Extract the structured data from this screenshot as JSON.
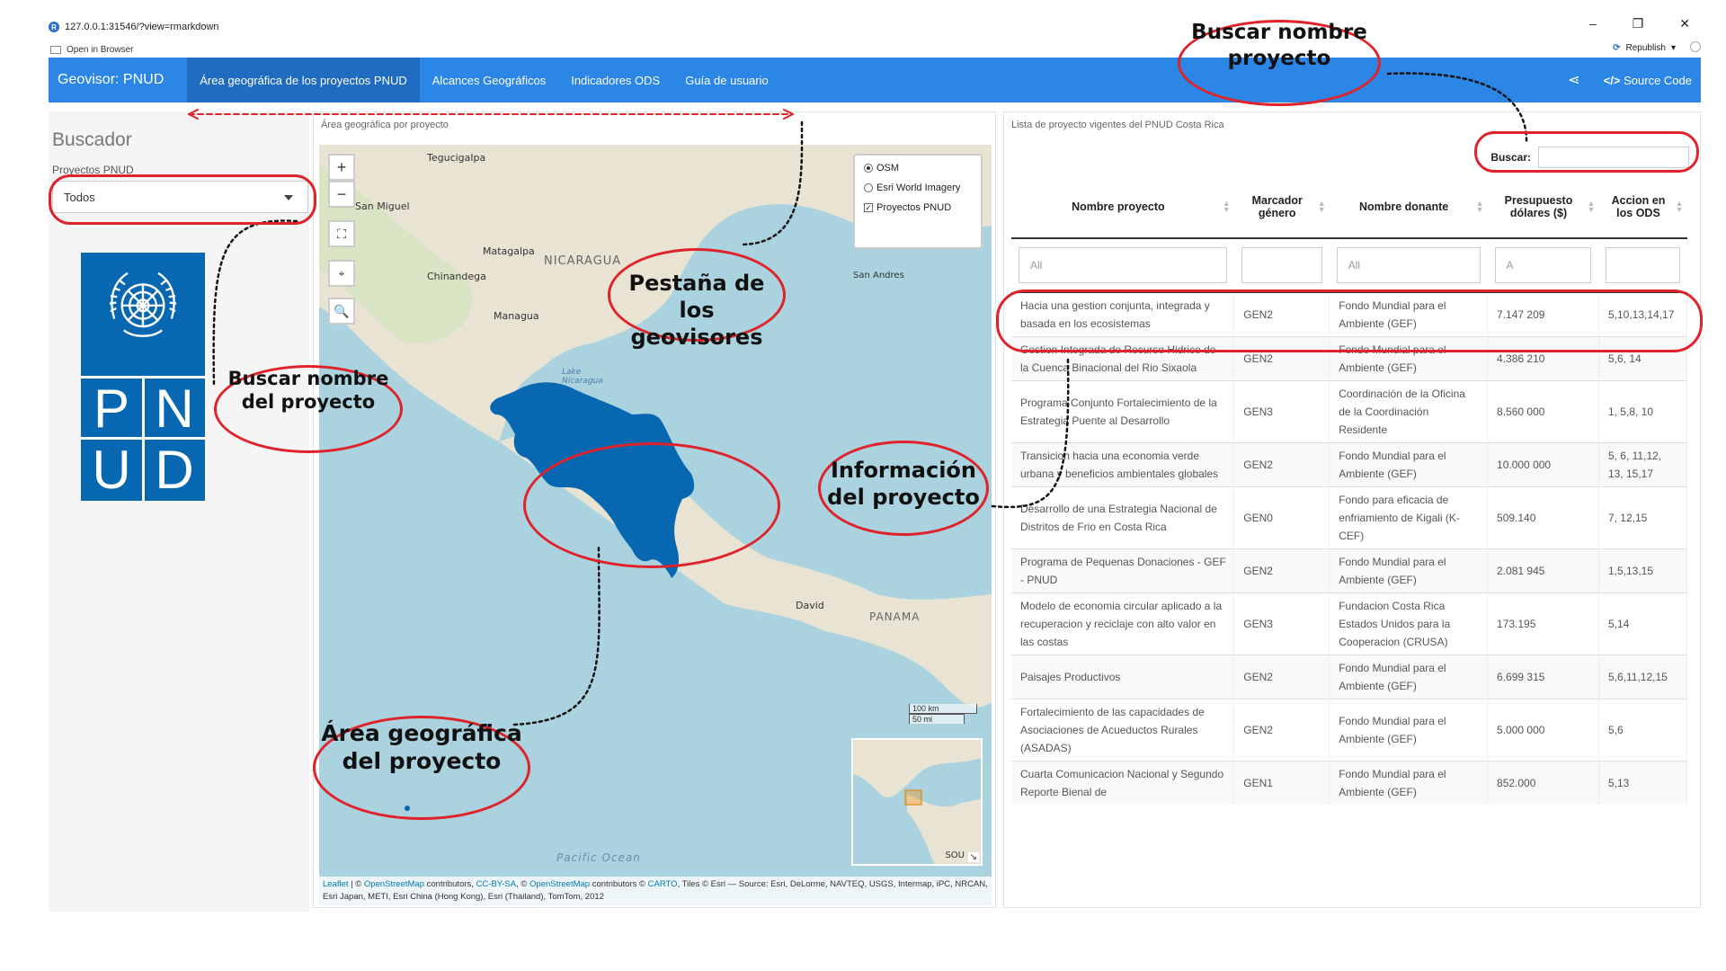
{
  "browser": {
    "url": "127.0.0.1:31546/?view=rmarkdown",
    "open_in_browser": "Open in Browser",
    "republish": "Republish"
  },
  "navbar": {
    "brand": "Geovisor: PNUD",
    "tabs": [
      {
        "label": "Área geográfica de los proyectos PNUD",
        "active": true
      },
      {
        "label": "Alcances Geográficos",
        "active": false
      },
      {
        "label": "Indicadores ODS",
        "active": false
      },
      {
        "label": "Guía de usuario",
        "active": false
      }
    ],
    "source_code": "Source Code"
  },
  "sidebar": {
    "title": "Buscador",
    "select_label": "Proyectos PNUD",
    "select_value": "Todos",
    "logo_letters": [
      "P",
      "N",
      "U",
      "D"
    ]
  },
  "map": {
    "heading": "Área geográfica por proyecto",
    "layers": [
      {
        "label": "OSM",
        "type": "radio",
        "checked": true
      },
      {
        "label": "Esri World Imagery",
        "type": "radio",
        "checked": false
      },
      {
        "label": "Proyectos PNUD",
        "type": "checkbox",
        "checked": true
      }
    ],
    "place_labels": [
      "Tegucigalpa",
      "San Miguel",
      "Matagalpa",
      "Chinandega",
      "NICARAGUA",
      "Managua",
      "Lake Nicaragua",
      "San Andres",
      "David",
      "PANAMA",
      "Pacific Ocean"
    ],
    "scale_km": "100 km",
    "scale_mi": "50 mi",
    "minimap_label": "SOU",
    "attribution": {
      "leaflet": "Leaflet",
      "osm1": "OpenStreetMap",
      "t1": " contributors, ",
      "ccbysa": "CC-BY-SA",
      "t2": ", © ",
      "osm2": "OpenStreetMap",
      "t3": " contributors © ",
      "carto": "CARTO",
      "t4": ", Tiles © Esri — Source: Esri, DeLorme, NAVTEQ, USGS, Intermap, iPC, NRCAN, Esri Japan, METI, Esri China (Hong Kong), Esri (Thailand), TomTom, 2012"
    },
    "project_color": "#0767b0"
  },
  "table": {
    "heading": "Lista de proyecto vigentes del PNUD Costa Rica",
    "search_label": "Buscar:",
    "columns": [
      "Nombre proyecto",
      "Marcador género",
      "Nombre donante",
      "Presupuesto dólares ($)",
      "Accion en los ODS"
    ],
    "filters": [
      "All",
      "",
      "All",
      "A",
      ""
    ],
    "rows": [
      [
        "Hacia una gestion conjunta, integrada y basada en los ecosistemas",
        "GEN2",
        "Fondo Mundial para el Ambiente (GEF)",
        "7.147 209",
        "5,10,13,14,17"
      ],
      [
        "Gestion Integrada de Recurso Hidrico de la Cuenca Binacional del Rio Sixaola",
        "GEN2",
        "Fondo Mundial para el Ambiente (GEF)",
        "4.386 210",
        "5,6, 14"
      ],
      [
        "Programa Conjunto Fortalecimiento de la Estrategia Puente al Desarrollo",
        "GEN3",
        "Coordinación de la Oficina de la Coordinación Residente",
        "8.560 000",
        "1, 5,8, 10"
      ],
      [
        "Transicion hacia una economia verde urbana y beneficios ambientales globales",
        "GEN2",
        "Fondo Mundial para el Ambiente (GEF)",
        "10.000 000",
        "5, 6, 11,12, 13, 15,17"
      ],
      [
        "Desarrollo de una Estrategia Nacional de Distritos de Frio en Costa Rica",
        "GEN0",
        "Fondo para eficacia de enfriamiento de Kigali (K-CEF)",
        "509.140",
        "7, 12,15"
      ],
      [
        "Programa de Pequenas Donaciones - GEF - PNUD",
        "GEN2",
        "Fondo Mundial para el Ambiente (GEF)",
        "2.081 945",
        "1,5,13,15"
      ],
      [
        "Modelo de economia circular aplicado a la recuperacion y reciclaje con alto valor en las costas",
        "GEN3",
        "Fundacion Costa Rica Estados Unidos para la Cooperacion (CRUSA)",
        "173.195",
        "5,14"
      ],
      [
        "Paisajes Productivos",
        "GEN2",
        "Fondo Mundial para el Ambiente (GEF)",
        "6.699 315",
        "5,6,11,12,15"
      ],
      [
        "Fortalecimiento de las capacidades de Asociaciones de Acueductos Rurales (ASADAS)",
        "GEN2",
        "Fondo Mundial para el Ambiente (GEF)",
        "5.000 000",
        "5,6"
      ],
      [
        "Cuarta Comunicacion Nacional y Segundo Reporte Bienal de",
        "GEN1",
        "Fondo Mundial para el Ambiente (GEF)",
        "852.000",
        "5,13"
      ]
    ]
  },
  "annotations": {
    "color": "#e0222a",
    "buscar_nombre_proyecto": "Buscar nombre proyecto",
    "pestana": "Pestaña de los geovisores",
    "buscar_nombre_del_proyecto": "Buscar nombre del proyecto",
    "informacion": "Información del proyecto",
    "area_geografica": "Área geográfica del proyecto"
  }
}
